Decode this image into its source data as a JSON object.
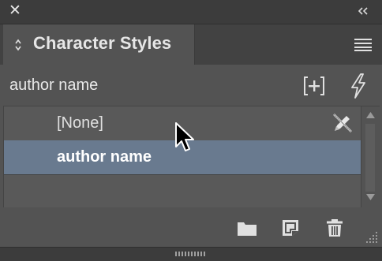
{
  "window": {
    "close_glyph": "✕",
    "collapse_icon": "double-chevron-left-icon"
  },
  "tab": {
    "title": "Character Styles",
    "menu_icon": "panel-menu-icon"
  },
  "toolbar": {
    "current_style": "author name",
    "new_style_icon": "new-style-group-icon",
    "quick_apply_icon": "lightning-bolt-icon"
  },
  "styles": {
    "items": [
      {
        "label": "[None]",
        "selected": false,
        "icon": "no-edit-pen-icon"
      },
      {
        "label": "author name",
        "selected": true
      }
    ]
  },
  "bottom": {
    "icons": [
      "folder-icon",
      "new-style-icon",
      "trash-icon"
    ]
  },
  "colors": {
    "panel": "#535353",
    "selection": "#697a8f",
    "chrome": "#3c3c3c"
  }
}
